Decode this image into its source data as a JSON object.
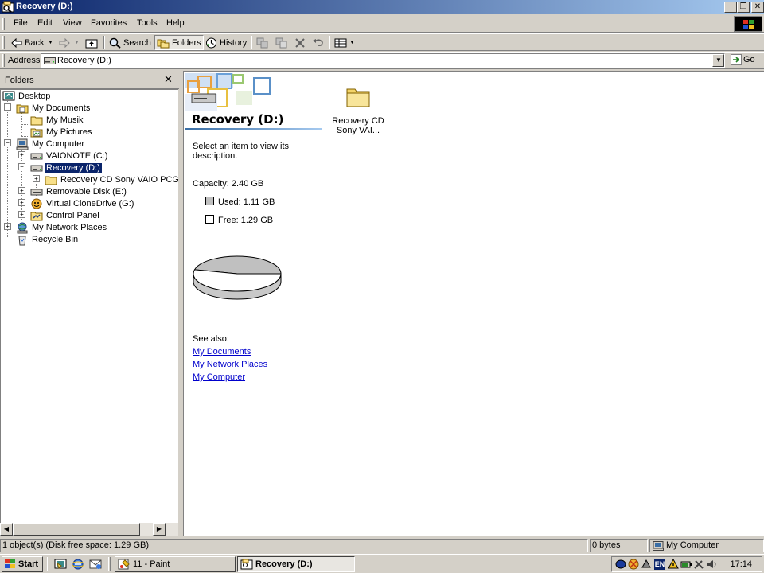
{
  "window": {
    "title": "Recovery (D:)"
  },
  "menu": {
    "items": [
      "File",
      "Edit",
      "View",
      "Favorites",
      "Tools",
      "Help"
    ]
  },
  "toolbar": {
    "back": "Back",
    "search": "Search",
    "folders": "Folders",
    "history": "History"
  },
  "address": {
    "label": "Address",
    "value": "Recovery (D:)",
    "go": "Go"
  },
  "folders_pane": {
    "title": "Folders",
    "tree": [
      {
        "label": "Desktop",
        "icon": "desktop-icon"
      },
      {
        "label": "My Documents",
        "icon": "my-documents-icon"
      },
      {
        "label": "My Musik",
        "icon": "folder-icon"
      },
      {
        "label": "My Pictures",
        "icon": "my-pictures-icon"
      },
      {
        "label": "My Computer",
        "icon": "my-computer-icon"
      },
      {
        "label": "VAIONOTE (C:)",
        "icon": "drive-icon"
      },
      {
        "label": "Recovery (D:)",
        "icon": "drive-icon",
        "selected": true
      },
      {
        "label": "Recovery CD Sony VAIO PCG-SR",
        "icon": "folder-icon"
      },
      {
        "label": "Removable Disk (E:)",
        "icon": "removable-disk-icon"
      },
      {
        "label": "Virtual CloneDrive (G:)",
        "icon": "clonedrive-icon"
      },
      {
        "label": "Control Panel",
        "icon": "control-panel-icon"
      },
      {
        "label": "My Network Places",
        "icon": "network-places-icon"
      },
      {
        "label": "Recycle Bin",
        "icon": "recycle-bin-icon"
      }
    ]
  },
  "content": {
    "drive_title": "Recovery (D:)",
    "select_text": "Select an item to view its description.",
    "capacity": "Capacity: 2.40 GB",
    "used": "Used: 1.11 GB",
    "free": "Free: 1.29 GB",
    "used_fraction": 0.4625,
    "see_also": "See also:",
    "links": [
      "My Documents",
      "My Network Places",
      "My Computer"
    ],
    "file": {
      "name": "Recovery CD Sony VAI...",
      "icon": "folder-icon"
    }
  },
  "status": {
    "objects": "1 object(s) (Disk free space: 1.29 GB)",
    "size": "0 bytes",
    "zone": "My Computer"
  },
  "taskbar": {
    "start": "Start",
    "tasks": [
      "11 - Paint",
      "Recovery (D:)"
    ],
    "tray": {
      "language": "EN",
      "clock": "17:14"
    }
  },
  "colors": {
    "titlebar_start": "#0a246a",
    "titlebar_end": "#a6caf0",
    "selection": "#0a246a",
    "link": "#0000cc",
    "used_slice": "#c0c0c0",
    "free_slice": "#ffffff"
  }
}
